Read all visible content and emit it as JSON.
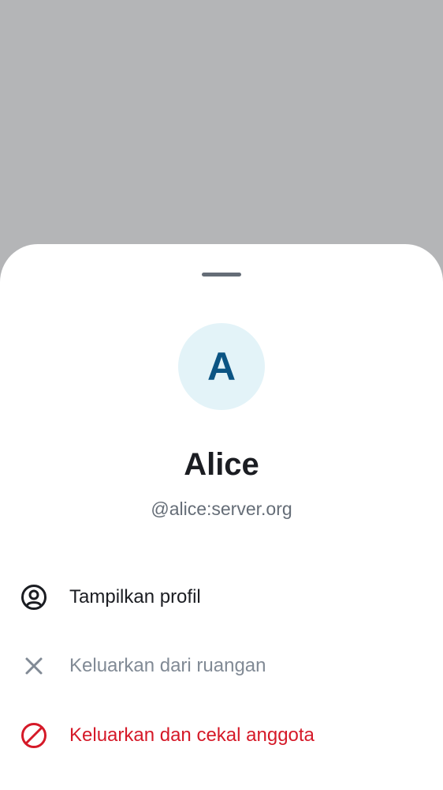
{
  "colors": {
    "scrim": "#b4b5b7",
    "avatar_bg": "#e3f3f8",
    "avatar_text": "#0b5483",
    "primary_text": "#1b1d22",
    "secondary_text": "#656d77",
    "disabled_text": "#818a95",
    "critical": "#d51928"
  },
  "member": {
    "avatar_initial": "A",
    "display_name": "Alice",
    "user_id": "@alice:server.org"
  },
  "actions": [
    {
      "icon": "user-profile-icon",
      "label": "Tampilkan profil"
    },
    {
      "icon": "close-icon",
      "label": "Keluarkan dari ruangan"
    },
    {
      "icon": "ban-icon",
      "label": "Keluarkan dan cekal anggota"
    }
  ]
}
